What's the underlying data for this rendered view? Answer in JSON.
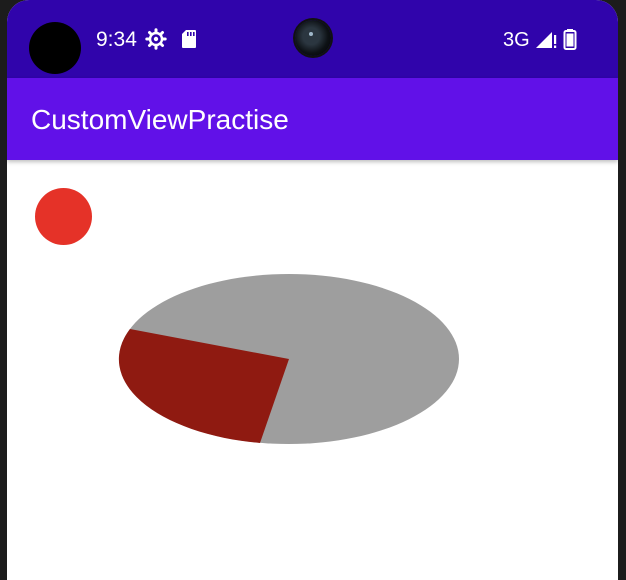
{
  "status_bar": {
    "time": "9:34",
    "network": "3G",
    "icons": [
      "settings-gear-icon",
      "sd-card-icon",
      "signal-icon",
      "battery-icon"
    ]
  },
  "app_bar": {
    "title": "CustomViewPractise",
    "color": "#6111e8"
  },
  "status_bar_color": "#3004ab",
  "content": {
    "dot_color": "#e53228",
    "pie": {
      "background_color": "#9e9e9e",
      "slice_color": "#8f1a11",
      "slice_fraction": 0.27
    }
  }
}
